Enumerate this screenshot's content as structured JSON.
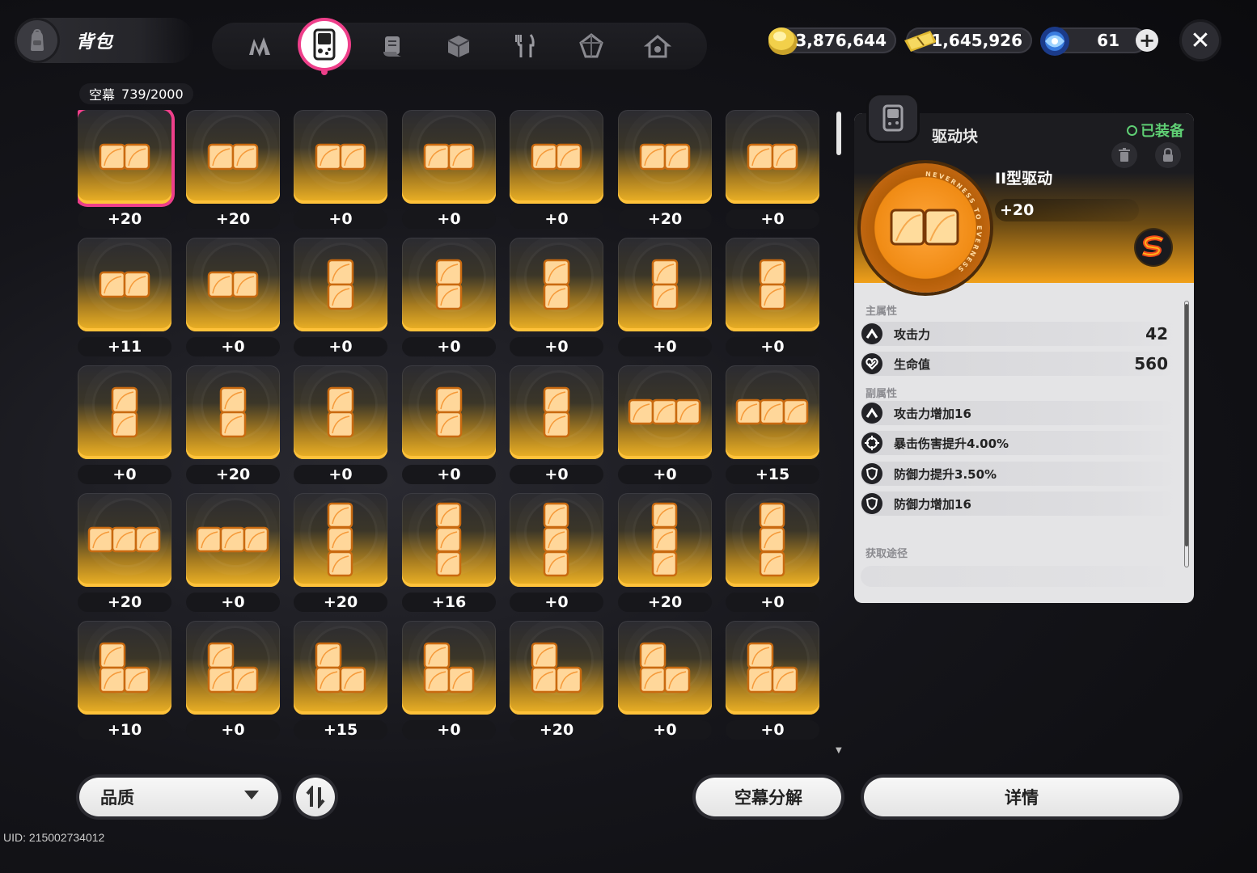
{
  "header": {
    "title": "背包",
    "tabs": [
      {
        "icon": "agent-icon",
        "active": false
      },
      {
        "icon": "game-console-icon",
        "active": true
      },
      {
        "icon": "scroll-icon",
        "active": false
      },
      {
        "icon": "cube-icon",
        "active": false
      },
      {
        "icon": "fork-knife-icon",
        "active": false
      },
      {
        "icon": "crystal-icon",
        "active": false
      },
      {
        "icon": "house-icon",
        "active": false
      }
    ],
    "currencies": [
      {
        "icon": "coin-icon",
        "value": "3,876,644"
      },
      {
        "icon": "ticket-icon",
        "value": "1,645,926"
      },
      {
        "icon": "polychrome-icon",
        "value": "61"
      }
    ]
  },
  "inventory": {
    "category": "空幕",
    "count": "739/2000",
    "items": [
      {
        "shape": "h2",
        "level": "+20",
        "selected": true
      },
      {
        "shape": "h2",
        "level": "+20"
      },
      {
        "shape": "h2",
        "level": "+0"
      },
      {
        "shape": "h2",
        "level": "+0"
      },
      {
        "shape": "h2",
        "level": "+0"
      },
      {
        "shape": "h2",
        "level": "+20"
      },
      {
        "shape": "h2",
        "level": "+0"
      },
      {
        "shape": "h2",
        "level": "+11"
      },
      {
        "shape": "h2",
        "level": "+0"
      },
      {
        "shape": "v2",
        "level": "+0"
      },
      {
        "shape": "v2",
        "level": "+0"
      },
      {
        "shape": "v2",
        "level": "+0"
      },
      {
        "shape": "v2",
        "level": "+0"
      },
      {
        "shape": "v2",
        "level": "+0"
      },
      {
        "shape": "v2",
        "level": "+0"
      },
      {
        "shape": "v2",
        "level": "+20"
      },
      {
        "shape": "v2",
        "level": "+0"
      },
      {
        "shape": "v2",
        "level": "+0"
      },
      {
        "shape": "v2",
        "level": "+0"
      },
      {
        "shape": "h3",
        "level": "+0"
      },
      {
        "shape": "h3",
        "level": "+15"
      },
      {
        "shape": "h3",
        "level": "+20"
      },
      {
        "shape": "h3",
        "level": "+0"
      },
      {
        "shape": "v3",
        "level": "+20"
      },
      {
        "shape": "v3",
        "level": "+16"
      },
      {
        "shape": "v3",
        "level": "+0"
      },
      {
        "shape": "v3",
        "level": "+20"
      },
      {
        "shape": "v3",
        "level": "+0"
      },
      {
        "shape": "L",
        "level": "+10"
      },
      {
        "shape": "L",
        "level": "+0"
      },
      {
        "shape": "L",
        "level": "+15"
      },
      {
        "shape": "L",
        "level": "+0"
      },
      {
        "shape": "L",
        "level": "+20"
      },
      {
        "shape": "L",
        "level": "+0"
      },
      {
        "shape": "L",
        "level": "+0"
      }
    ]
  },
  "detail": {
    "tab_icon": "game-console-icon",
    "header": "驱动块",
    "equipped": "已装备",
    "medal_text": "NEVERNESS TO EVERNESS",
    "name": "II型驱动",
    "level": "+20",
    "main_label": "主属性",
    "main_stats": [
      {
        "icon": "attack-icon",
        "name": "攻击力",
        "value": "42"
      },
      {
        "icon": "heart-icon",
        "name": "生命值",
        "value": "560"
      }
    ],
    "sub_label": "副属性",
    "sub_stats": [
      {
        "icon": "attack-icon",
        "name": "攻击力增加16"
      },
      {
        "icon": "crit-icon",
        "name": "暴击伤害提升4.00%"
      },
      {
        "icon": "shield-icon",
        "name": "防御力提升3.50%"
      },
      {
        "icon": "shield-icon",
        "name": "防御力增加16"
      }
    ],
    "source_label": "获取途径"
  },
  "footer": {
    "sort_label": "品质",
    "decompose_label": "空幕分解",
    "details_label": "详情",
    "uid": "UID: 215002734012"
  },
  "colors": {
    "accent": "#ee3f8a",
    "gold": "#f0b425",
    "equipped_green": "#5fcf74"
  }
}
